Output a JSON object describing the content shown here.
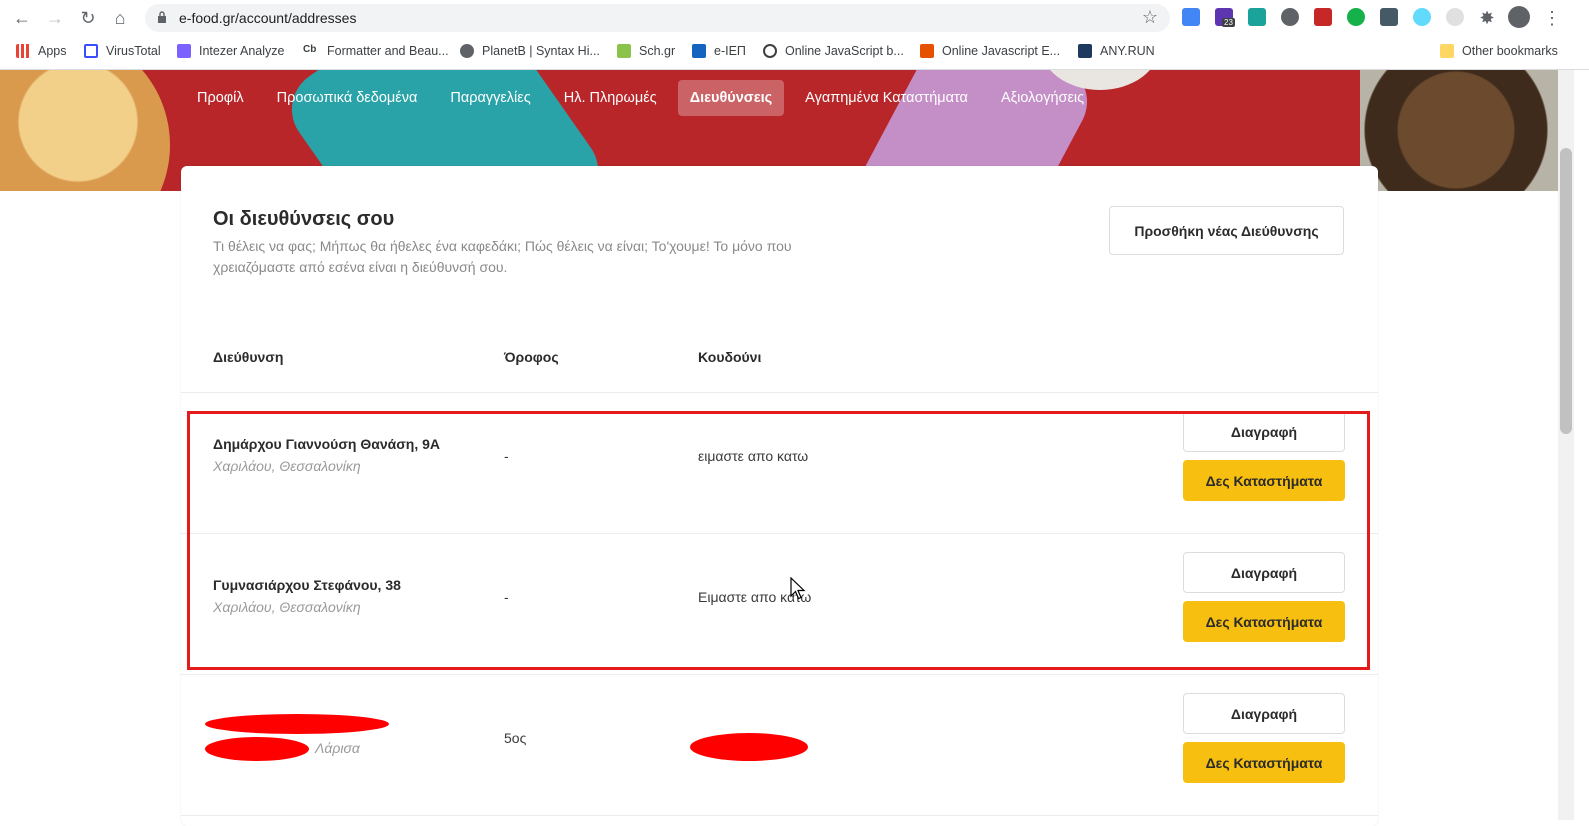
{
  "browser": {
    "url": "e-food.gr/account/addresses",
    "bookmarks": [
      "Apps",
      "VirusTotal",
      "Intezer Analyze",
      "Formatter and Beau...",
      "PlanetB | Syntax Hi...",
      "Sch.gr",
      "e-ΙΕΠ",
      "Online JavaScript b...",
      "Online Javascript E...",
      "ANY.RUN"
    ],
    "other_bookmarks": "Other bookmarks",
    "extension_badge": "23"
  },
  "nav": {
    "tabs": [
      "Προφίλ",
      "Προσωπικά δεδομένα",
      "Παραγγελίες",
      "Ηλ. Πληρωμές",
      "Διευθύνσεις",
      "Αγαπημένα Καταστήματα",
      "Αξιολογήσεις"
    ],
    "active_index": 4
  },
  "page": {
    "title": "Οι διευθύνσεις σου",
    "subtitle": "Τι θέλεις να φας; Μήπως θα ήθελες ένα καφεδάκι; Πώς θέλεις να είναι; Το'χουμε! Το μόνο που χρειαζόμαστε από εσένα είναι η διεύθυνσή σου.",
    "add_button": "Προσθήκη νέας Διεύθυνσης"
  },
  "table": {
    "headers": [
      "Διεύθυνση",
      "Όροφος",
      "Κουδούνι"
    ],
    "rows": [
      {
        "address": "Δημάρχου Γιαννούση Θανάση, 9Α",
        "area": "Χαριλάου, Θεσσαλονίκη",
        "floor": "-",
        "bell": "ειμαστε απο κατω",
        "delete": "Διαγραφή",
        "shops": "Δες Καταστήματα"
      },
      {
        "address": "Γυμνασιάρχου Στεφάνου, 38",
        "area": "Χαριλάου, Θεσσαλονίκη",
        "floor": "-",
        "bell": "Ειμαστε απο κατω",
        "delete": "Διαγραφή",
        "shops": "Δες Καταστήματα"
      },
      {
        "address": "",
        "area": "Λάρισα",
        "floor": "5ος",
        "bell": "",
        "delete": "Διαγραφή",
        "shops": "Δες Καταστήματα"
      }
    ]
  },
  "colors": {
    "accent": "#f7bf0f",
    "hero": "#b8262a",
    "highlight": "#e31b1b"
  }
}
